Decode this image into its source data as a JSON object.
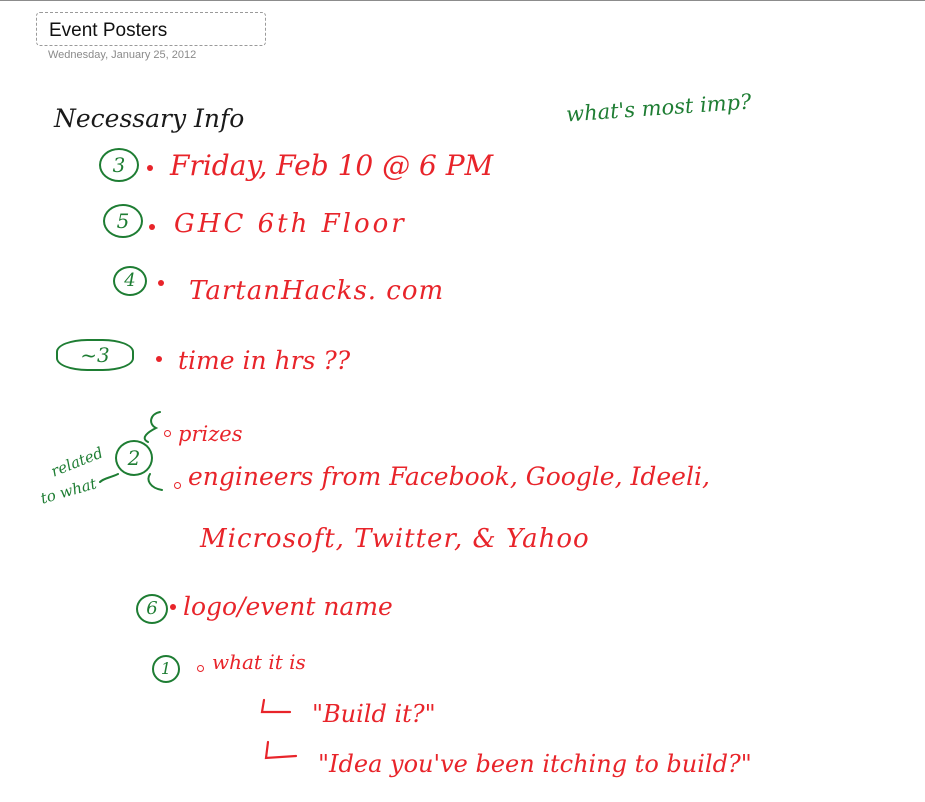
{
  "page": {
    "title": "Event Posters",
    "date": "Wednesday, January 25, 2012"
  },
  "notes": {
    "heading": "Necessary Info",
    "question": "what's most imp?",
    "items": [
      {
        "rank": "3",
        "text": "Friday, Feb 10 @ 6 PM"
      },
      {
        "rank": "5",
        "text": "GHC 6th Floor"
      },
      {
        "rank": "4",
        "text": "TartanHacks. com"
      },
      {
        "rank": "~3",
        "text": "time in hrs ??"
      },
      {
        "rank": "2",
        "text_a": "prizes",
        "text_b": "engineers from Facebook, Google, Ideeli,",
        "text_c": "Microsoft, Twitter, & Yahoo"
      },
      {
        "rank": "6",
        "text": "logo/event name"
      },
      {
        "rank": "1",
        "text": "what it is"
      }
    ],
    "side_note_line1": "related",
    "side_note_line2": "to what",
    "sub_items": [
      "\"Build it?\"",
      "\"Idea you've been itching to build?\""
    ]
  },
  "colors": {
    "heading_ink": "#1a1a1a",
    "item_ink": "#e8242a",
    "rank_ink": "#1e7d33",
    "title_border": "#9a9a9a",
    "date_text": "#8a8a8a"
  }
}
